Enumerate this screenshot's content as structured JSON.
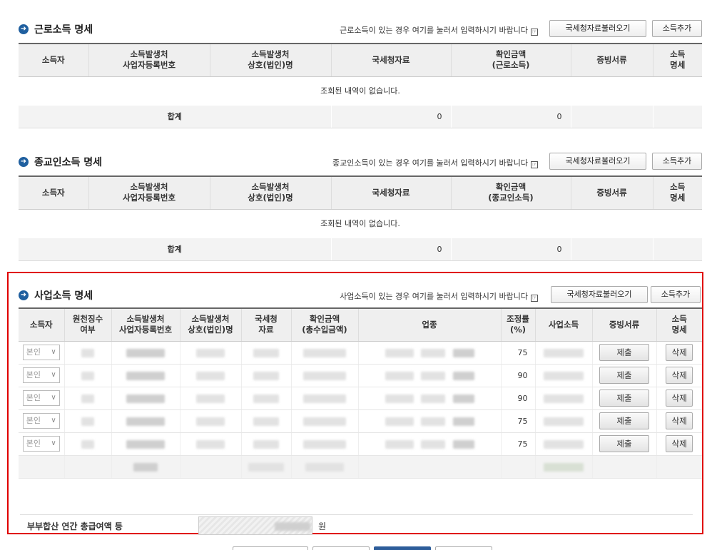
{
  "hint_icon": "note-icon",
  "bullet_icon": "arrow-right-circle-icon",
  "labor": {
    "title": "근로소득 명세",
    "hint": "근로소득이 있는 경우 여기를 눌러서 입력하시기 바랍니다",
    "btn_load": "국세청자료불러오기",
    "btn_add": "소득추가",
    "headers": [
      "소득자",
      "소득발생처\n사업자등록번호",
      "소득발생처\n상호(법인)명",
      "국세청자료",
      "확인금액\n(근로소득)",
      "증빙서류",
      "소득\n명세"
    ],
    "empty_text": "조회된 내역이 없습니다.",
    "sum_label": "합계",
    "sum_nts": "0",
    "sum_confirmed": "0"
  },
  "religious": {
    "title": "종교인소득 명세",
    "hint": "종교인소득이 있는 경우 여기를 눌러서 입력하시기 바랍니다",
    "btn_load": "국세청자료불러오기",
    "btn_add": "소득추가",
    "headers": [
      "소득자",
      "소득발생처\n사업자등록번호",
      "소득발생처\n상호(법인)명",
      "국세청자료",
      "확인금액\n(종교인소득)",
      "증빙서류",
      "소득\n명세"
    ],
    "empty_text": "조회된 내역이 없습니다.",
    "sum_label": "합계",
    "sum_nts": "0",
    "sum_confirmed": "0"
  },
  "business": {
    "title": "사업소득 명세",
    "hint": "사업소득이 있는 경우 여기를 눌러서 입력하시기 바랍니다",
    "btn_load": "국세청자료불러오기",
    "btn_add": "소득추가",
    "headers": [
      "소득자",
      "원천징수\n여부",
      "소득발생처\n사업자등록번호",
      "소득발생처\n상호(법인)명",
      "국세청\n자료",
      "확인금액\n(총수입금액)",
      "업종",
      "조정률\n(%)",
      "사업소득",
      "증빙서류",
      "소득\n명세"
    ],
    "rows": [
      {
        "earner": "본인",
        "rate": "75",
        "submit": "제출",
        "delete": "삭제"
      },
      {
        "earner": "본인",
        "rate": "90",
        "submit": "제출",
        "delete": "삭제"
      },
      {
        "earner": "본인",
        "rate": "90",
        "submit": "제출",
        "delete": "삭제"
      },
      {
        "earner": "본인",
        "rate": "75",
        "submit": "제출",
        "delete": "삭제"
      },
      {
        "earner": "본인",
        "rate": "75",
        "submit": "제출",
        "delete": "삭제"
      }
    ],
    "spouse_label": "부부합산 연간 총급여액 등",
    "spouse_unit": "원"
  },
  "colors": {
    "highlight_border": "#e00000",
    "bullet": "#1f5f9f"
  }
}
